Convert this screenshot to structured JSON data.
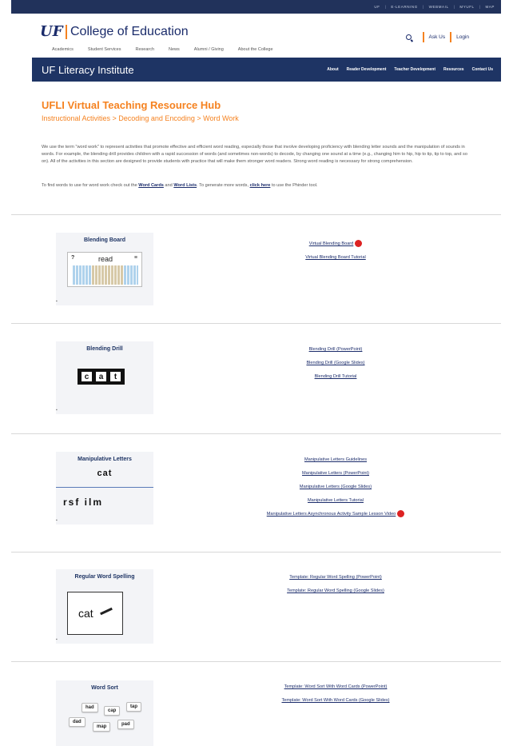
{
  "topbar": {
    "links": [
      "UF",
      "|",
      "E-LEARNING",
      "|",
      "WEBMAIL",
      "|",
      "MYUFL",
      "|",
      "MAP"
    ]
  },
  "header": {
    "logo_uf": "UF",
    "logo_college": "College of Education",
    "utility": {
      "ask_us": "Ask Us",
      "login": "Login"
    },
    "nav": [
      "Academics",
      "Student Services",
      "Research",
      "News",
      "Alumni / Giving",
      "About the College"
    ]
  },
  "site": {
    "name": "UF Literacy Institute",
    "nav": [
      "About",
      "Reader Development",
      "Teacher Development",
      "Resources",
      "Contact Us"
    ]
  },
  "page": {
    "title": "UFLI Virtual Teaching Resource Hub",
    "breadcrumb": "Instructional Activities > Decoding and Encoding > Word Work",
    "intro": "We use the term \"word work\" to represent activities that promote effective and efficient word reading, especially those that involve developing proficiency with blending letter sounds and the manipulation of sounds in words.  For example, the blending drill provides children with a rapid succession of words (and sometimes non-words) to decode, by changing one sound at a time (e.g., changing him to hip, hip to tip, tip to top, and so on).  All of the activities in this section are designed to provide students with practice that will make them stronger word readers.  Strong word reading is necessary for strong comprehension.",
    "find_words": {
      "t1": "To find words to use for word work check out the ",
      "word_cards": "Word Cards",
      "t2": " and ",
      "word_lists": "Word Lists",
      "t3": ".  To generate more words, ",
      "click_here": "click here",
      "t4": " to use the Phinder tool."
    }
  },
  "sections": [
    {
      "card_title": "Blending Board",
      "card_word": "read",
      "card_q": "?",
      "card_eq": "≡",
      "links": [
        "Virtual Blending Board",
        "Virtual Blending Board Tutorial"
      ]
    },
    {
      "card_title": "Blending Drill",
      "tiles": [
        "c",
        "a",
        "t"
      ],
      "links": [
        "Blending Drill (PowerPoint)",
        "Blending Drill (Google Slides)",
        "Blending Drill Tutorial"
      ]
    },
    {
      "card_title": "Manipulative Letters",
      "card_word": "cat",
      "card_letters": "rsf ilm",
      "links": [
        "Manipulative Letters Guidelines",
        "Manipulative Letters (PowerPoint)",
        "Manipulative Letters (Google Slides)",
        "Manipulative Letters Tutorial",
        "Manipulative Letters Asynchronous Activity Sample Lesson Video"
      ]
    },
    {
      "card_title": "Regular Word Spelling",
      "card_word": "cat",
      "links": [
        "Template: Regular Word Spelling (PowerPoint)",
        "Template: Regular Word Spelling (Google Slides)"
      ]
    },
    {
      "card_title": "Word Sort",
      "sort_words": [
        "had",
        "cap",
        "tap",
        "dad",
        "map",
        "pad"
      ],
      "links": [
        "Template: Word Sort With Word Cards (PowerPoint)",
        "Template: Word Sort With Word Cards (Google Slides)"
      ]
    }
  ]
}
